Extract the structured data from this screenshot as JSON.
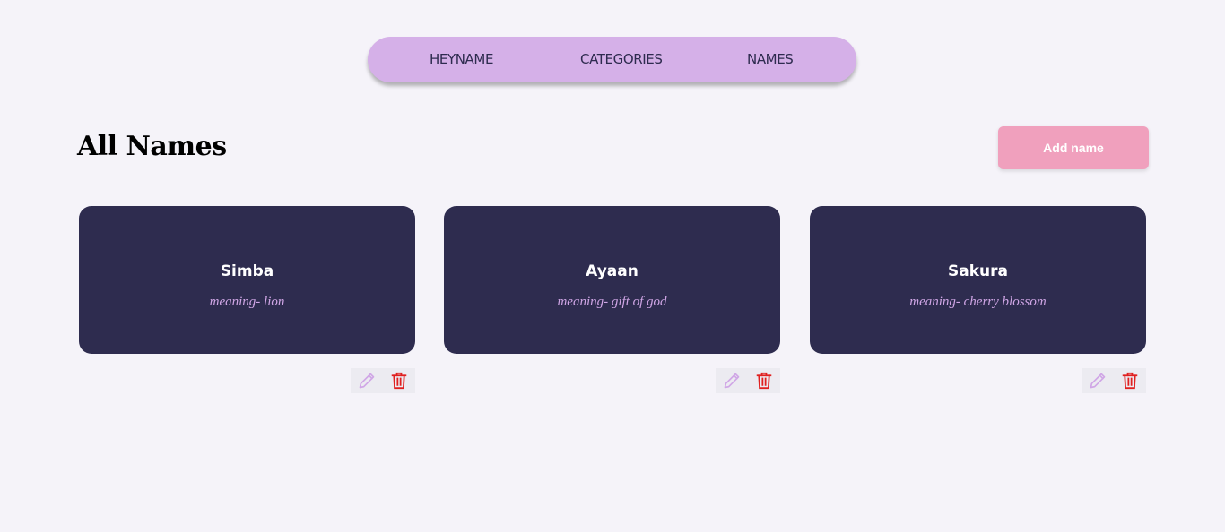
{
  "nav": {
    "items": [
      {
        "label": "HEYNAME"
      },
      {
        "label": "CATEGORIES"
      },
      {
        "label": "NAMES"
      }
    ]
  },
  "header": {
    "title": "All Names",
    "add_button_label": "Add name"
  },
  "cards": [
    {
      "name": "Simba",
      "meaning": "meaning- lion"
    },
    {
      "name": "Ayaan",
      "meaning": "meaning- gift of god"
    },
    {
      "name": "Sakura",
      "meaning": "meaning- cherry blossom"
    }
  ],
  "icons": {
    "edit": "pencil-icon",
    "delete": "trash-icon"
  },
  "colors": {
    "background": "#f5f3f9",
    "nav_bg": "#d5b0e8",
    "nav_text": "#2e2b4f",
    "card_bg": "#2e2c4f",
    "meaning_text": "#d0a6e6",
    "add_button_bg": "#f0a0bd",
    "edit_icon": "#d0a6e6",
    "delete_icon": "#e02020"
  }
}
